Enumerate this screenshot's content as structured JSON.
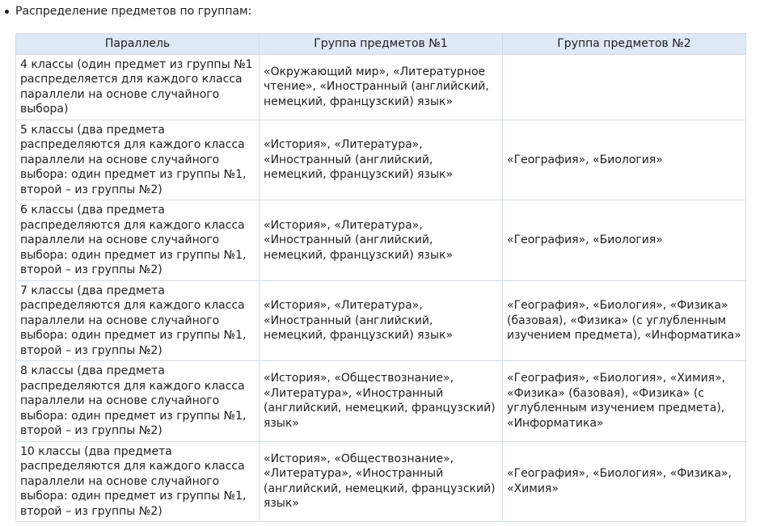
{
  "intro": {
    "bullet_text": "Распределение предметов по группам:"
  },
  "table": {
    "headers": [
      "Параллель",
      "Группа предметов №1",
      "Группа предметов №2"
    ],
    "rows": [
      {
        "parallel": "4 классы (один предмет из группы №1 распределяется для каждого класса параллели на основе случайного выбора)",
        "group1": "«Окружающий мир», «Литературное чтение», «Иностранный (английский, немецкий, французский) язык»",
        "group2": ""
      },
      {
        "parallel": "5 классы (два предмета распределяются для каждого класса параллели на основе случайного выбора: один предмет из группы №1, второй – из группы №2)",
        "group1": "«История», «Литература», «Иностранный (английский, немецкий, французский) язык»",
        "group2": "«География», «Биология»"
      },
      {
        "parallel": "6 классы (два предмета распределяются для каждого класса параллели на основе случайного выбора: один предмет из группы №1, второй – из группы №2)",
        "group1": "«История», «Литература», «Иностранный (английский, немецкий, французский) язык»",
        "group2": "«География», «Биология»"
      },
      {
        "parallel": "7 классы (два предмета распределяются для каждого класса параллели на основе случайного выбора: один предмет из группы №1, второй – из группы №2)",
        "group1": "«История», «Литература», «Иностранный (английский, немецкий, французский) язык»",
        "group2": "«География», «Биология», «Физика» (базовая), «Физика» (с углубленным изучением предмета), «Информатика»"
      },
      {
        "parallel": "8 классы (два предмета распределяются для каждого класса параллели на основе случайного выбора: один предмет из группы №1, второй – из группы №2)",
        "group1": "«История», «Обществознание», «Литература», «Иностранный (английский, немецкий, французский) язык»",
        "group2": "«География», «Биология», «Химия», «Физика» (базовая), «Физика» (с углубленным изучением предмета), «Информатика»"
      },
      {
        "parallel": "10 классы (два предмета распределяются для каждого класса параллели на основе случайного выбора: один предмет из группы №1, второй – из группы №2)",
        "group1": "«История», «Обществознание», «Литература», «Иностранный (английский, немецкий, французский) язык»",
        "group2": "«География», «Биология», «Физика», «Химия»"
      }
    ]
  }
}
